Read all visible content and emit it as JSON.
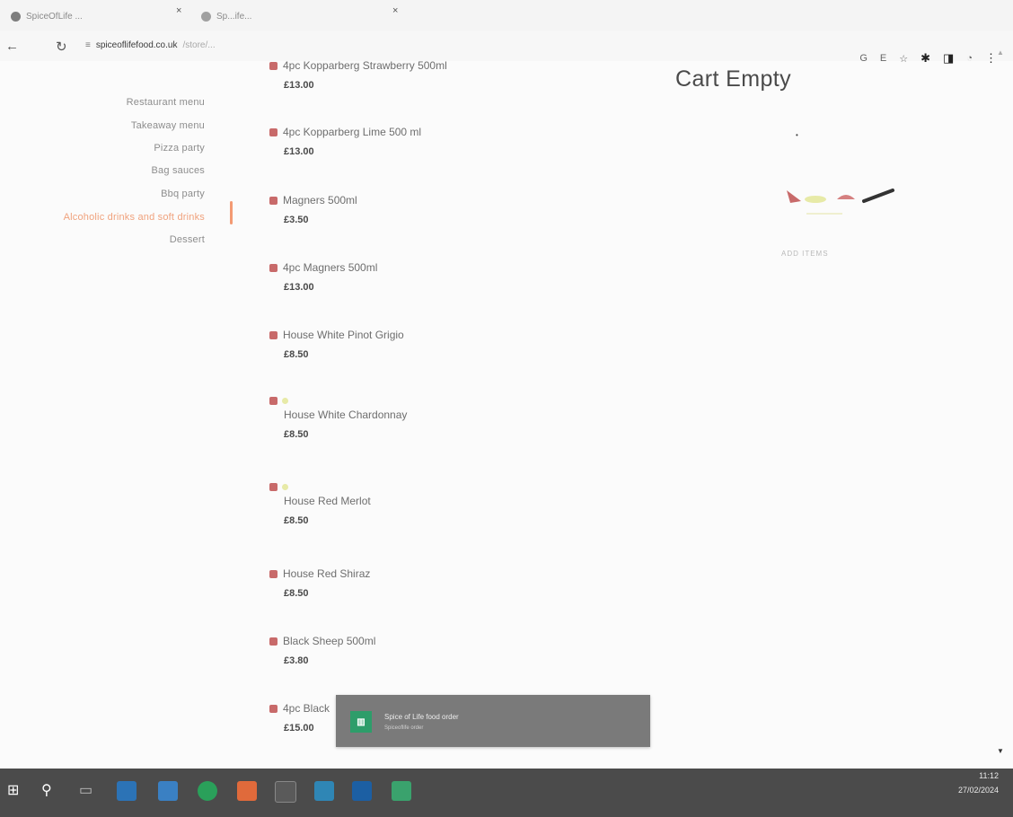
{
  "browser": {
    "tabs": [
      {
        "title": "SpiceOfLife ..."
      },
      {
        "title": "Sp...ife..."
      }
    ],
    "url_domain": "spiceoflifefood.co.uk",
    "url_path": "/store/..."
  },
  "sidebar": {
    "items": [
      {
        "label": "Restaurant menu",
        "active": false
      },
      {
        "label": "Takeaway menu",
        "active": false
      },
      {
        "label": "Pizza party",
        "active": false
      },
      {
        "label": "Bag sauces",
        "active": false
      },
      {
        "label": "Bbq party",
        "active": false
      },
      {
        "label": "Alcoholic drinks and soft drinks",
        "active": true
      },
      {
        "label": "Dessert",
        "active": false
      }
    ]
  },
  "products": [
    {
      "name": "4pc Kopparberg Strawberry 500ml",
      "price": "£13.00"
    },
    {
      "name": "4pc Kopparberg Lime 500 ml",
      "price": "£13.00"
    },
    {
      "name": "Magners 500ml",
      "price": "£3.50"
    },
    {
      "name": "4pc Magners 500ml",
      "price": "£13.00"
    },
    {
      "name": "House White Pinot Grigio",
      "price": "£8.50"
    },
    {
      "name": "House White Chardonnay",
      "price": "£8.50"
    },
    {
      "name": "House Red Merlot",
      "price": "£8.50"
    },
    {
      "name": "House Red Shiraz",
      "price": "£8.50"
    },
    {
      "name": "Black Sheep 500ml",
      "price": "£3.80"
    },
    {
      "name": "4pc Black",
      "price": "£15.00"
    }
  ],
  "cart": {
    "title": "Cart Empty",
    "subtext": "ADD ITEMS"
  },
  "toast": {
    "title": "Spice of Life food order",
    "subtitle": "Spiceoflife order"
  },
  "taskbar": {
    "time": "11:12",
    "date": "27/02/2024"
  },
  "colors": {
    "accent": "#f39a73",
    "veg_marker": "#c86a6a",
    "taskbar": "#4b4b4b"
  }
}
